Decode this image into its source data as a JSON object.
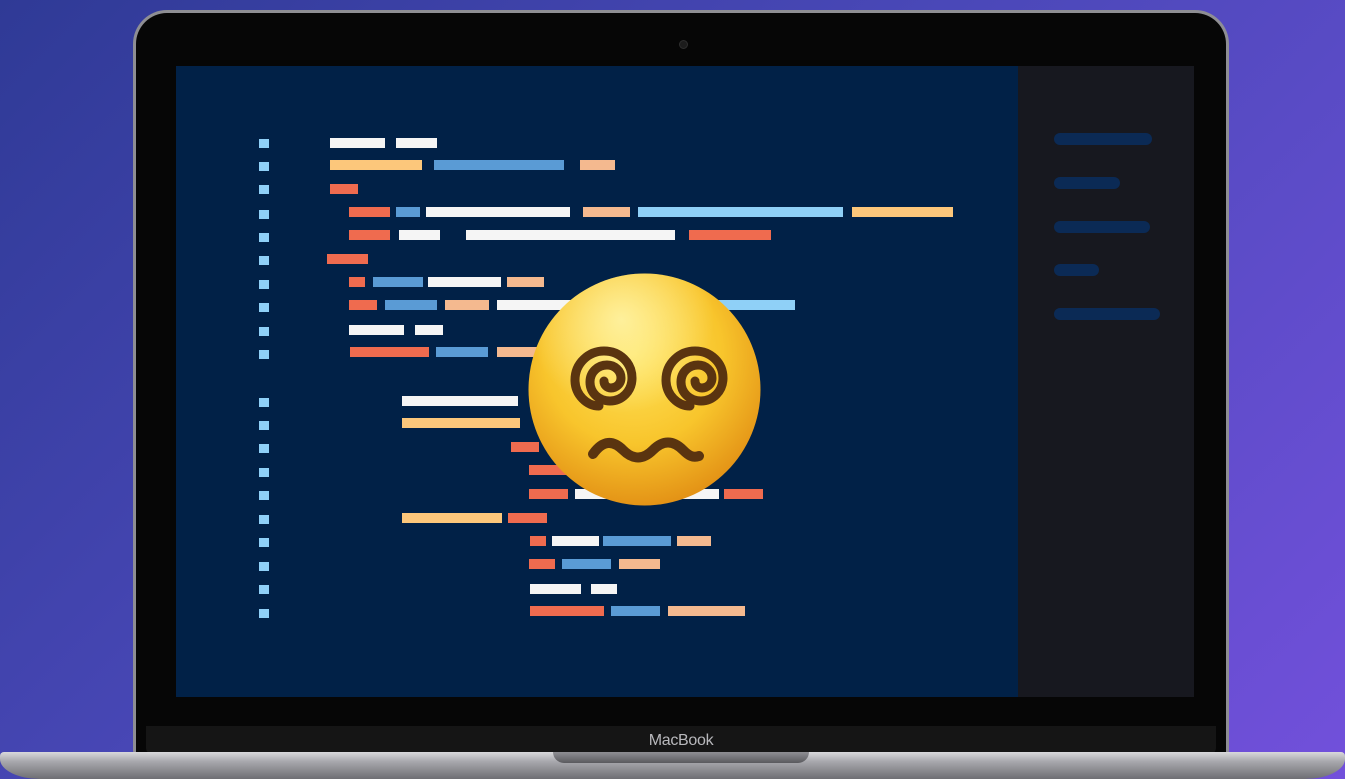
{
  "device": {
    "brand_label": "MacBook"
  },
  "colors": {
    "background_start": "#2f3a96",
    "background_end": "#7250db",
    "editor_background": "#012147",
    "side_panel": "#17181f",
    "gutter_marker": "#8fd0f7",
    "token_white": "#f5f5f5",
    "token_orange": "#fcc77b",
    "token_blue": "#5a9bd5",
    "token_peach": "#f4b98f",
    "token_red": "#ef6b4f",
    "token_light_blue": "#8fd0f7"
  },
  "overlay": {
    "icon": "dizzy-face-emoji-icon"
  }
}
